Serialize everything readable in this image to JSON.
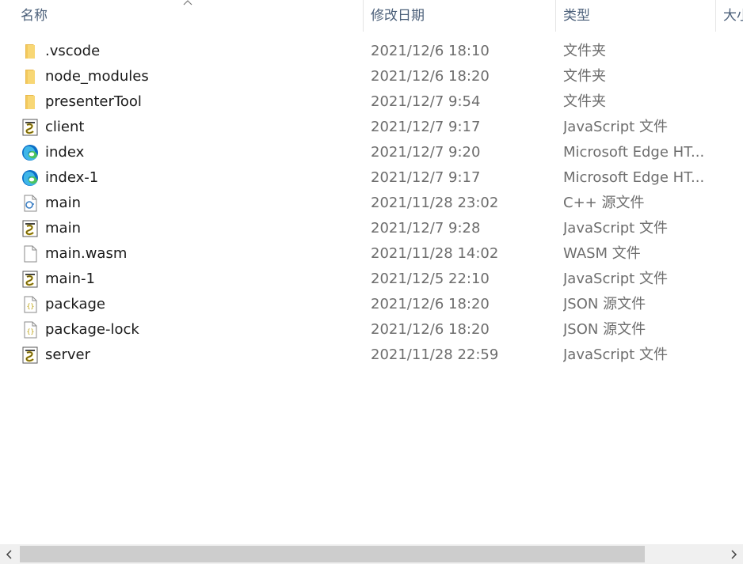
{
  "header": {
    "name_label": "名称",
    "date_label": "修改日期",
    "type_label": "类型",
    "size_label": "大小",
    "sort_direction": "ascending",
    "sort_icon": "chevron-up-icon"
  },
  "files": [
    {
      "name": ".vscode",
      "date": "2021/12/6 18:10",
      "type": "文件夹",
      "icon": "folder-icon"
    },
    {
      "name": "node_modules",
      "date": "2021/12/6 18:20",
      "type": "文件夹",
      "icon": "folder-icon"
    },
    {
      "name": "presenterTool",
      "date": "2021/12/7 9:54",
      "type": "文件夹",
      "icon": "folder-icon"
    },
    {
      "name": "client",
      "date": "2021/12/7 9:17",
      "type": "JavaScript 文件",
      "icon": "javascript-file-icon"
    },
    {
      "name": "index",
      "date": "2021/12/7 9:20",
      "type": "Microsoft Edge HT...",
      "icon": "edge-html-icon"
    },
    {
      "name": "index-1",
      "date": "2021/12/7 9:17",
      "type": "Microsoft Edge HT...",
      "icon": "edge-html-icon"
    },
    {
      "name": "main",
      "date": "2021/11/28 23:02",
      "type": "C++ 源文件",
      "icon": "cpp-file-icon"
    },
    {
      "name": "main",
      "date": "2021/12/7 9:28",
      "type": "JavaScript 文件",
      "icon": "javascript-file-icon"
    },
    {
      "name": "main.wasm",
      "date": "2021/11/28 14:02",
      "type": "WASM 文件",
      "icon": "blank-file-icon"
    },
    {
      "name": "main-1",
      "date": "2021/12/5 22:10",
      "type": "JavaScript 文件",
      "icon": "javascript-file-icon"
    },
    {
      "name": "package",
      "date": "2021/12/6 18:20",
      "type": "JSON 源文件",
      "icon": "json-file-icon"
    },
    {
      "name": "package-lock",
      "date": "2021/12/6 18:20",
      "type": "JSON 源文件",
      "icon": "json-file-icon"
    },
    {
      "name": "server",
      "date": "2021/11/28 22:59",
      "type": "JavaScript 文件",
      "icon": "javascript-file-icon"
    }
  ],
  "scrollbar": {
    "left_arrow": "‹",
    "right_arrow": "›",
    "position": 0
  },
  "colors": {
    "header_text": "#4c607a",
    "name_text": "#1a1a1a",
    "meta_text": "#6d6d6d",
    "folder": "#f8d775",
    "edge_blue": "#0c6fc7",
    "edge_green": "#4cc35f",
    "scroll_thumb": "#cdcdcd"
  }
}
